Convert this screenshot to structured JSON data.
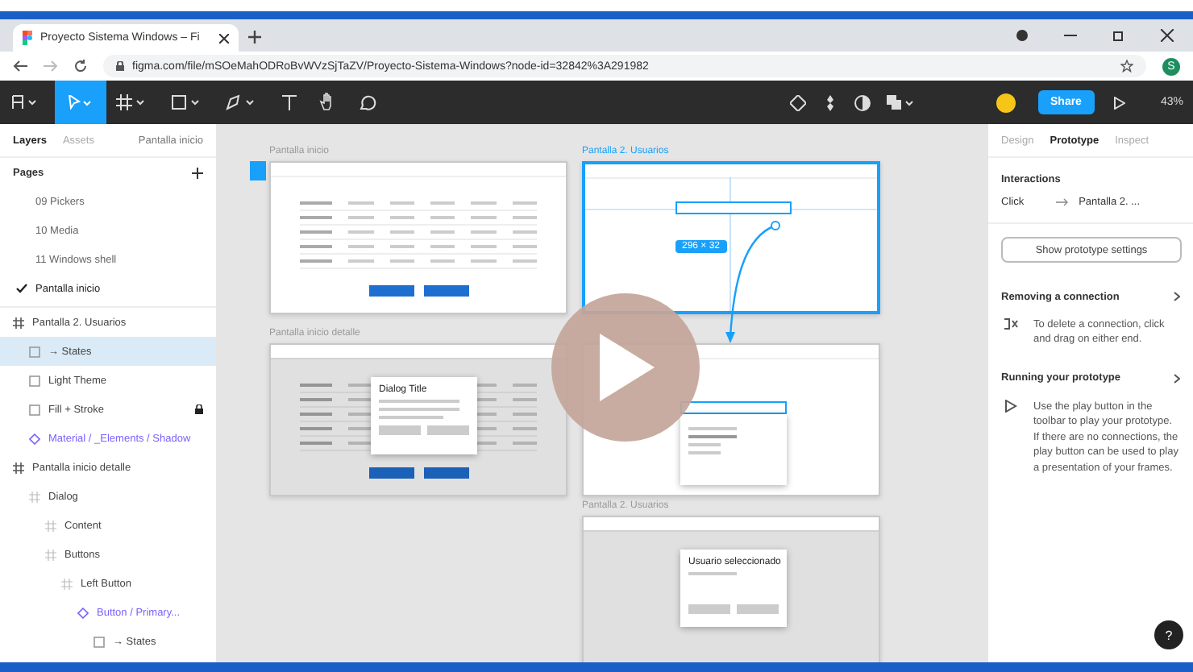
{
  "browser": {
    "tab_title": "Proyecto Sistema Windows – Fi",
    "address": "figma.com/file/mSOeMahODRoBvWVzSjTaZV/Proyecto-Sistema-Windows?node-id=32842%3A291982",
    "profile_initial": "S"
  },
  "toolbar": {
    "share": "Share",
    "zoom": "43%"
  },
  "left_panel": {
    "tabs": [
      {
        "label": "Layers",
        "selected": true
      },
      {
        "label": "Assets",
        "selected": false
      }
    ],
    "page_dropdown": "Pantalla inicio",
    "pages_heading": "Pages",
    "pages": [
      {
        "label": "09 Pickers",
        "selected": false
      },
      {
        "label": "10 Media",
        "selected": false
      },
      {
        "label": "11 Windows shell",
        "selected": false
      },
      {
        "label": "Pantalla inicio",
        "selected": true
      }
    ],
    "layers": [
      {
        "label": "Pantalla 2. Usuarios",
        "kind": "frame",
        "selected": false,
        "locked": false,
        "children": [
          {
            "label": "→ States",
            "kind": "rect",
            "selected": true,
            "locked": false
          },
          {
            "label": "Light Theme",
            "kind": "rect",
            "selected": false,
            "locked": false
          },
          {
            "label": "Fill + Stroke",
            "kind": "rect",
            "selected": false,
            "locked": true
          },
          {
            "label": "Material / _Elements / Shadow",
            "kind": "instance",
            "selected": false,
            "locked": false
          }
        ]
      },
      {
        "label": "Pantalla inicio detalle",
        "kind": "frame",
        "selected": false,
        "locked": false,
        "children": [
          {
            "label": "Dialog",
            "kind": "group",
            "selected": false,
            "locked": false,
            "children": [
              {
                "label": "Content",
                "kind": "group",
                "selected": false,
                "locked": false
              },
              {
                "label": "Buttons",
                "kind": "group",
                "selected": false,
                "locked": false,
                "children": [
                  {
                    "label": "Left Button",
                    "kind": "group",
                    "selected": false,
                    "locked": false,
                    "children": [
                      {
                        "label": "Button / Primary...",
                        "kind": "instance",
                        "selected": false,
                        "locked": false,
                        "children": [
                          {
                            "label": "→ States",
                            "kind": "rect",
                            "selected": false,
                            "locked": false
                          }
                        ]
                      }
                    ]
                  }
                ]
              }
            ]
          }
        ]
      }
    ]
  },
  "canvas": {
    "frames": [
      {
        "label": "Pantalla inicio",
        "kind": "table",
        "selected": false
      },
      {
        "label": "Pantalla 2. Usuarios",
        "kind": "input",
        "selected": true,
        "size_badge": "296 × 32"
      },
      {
        "label": "Pantalla inicio detalle",
        "kind": "dialog",
        "selected": false,
        "dialog_title": "Dialog Title"
      },
      {
        "kind": "dropdown",
        "selected": false
      },
      {
        "label": "Pantalla 2. Usuarios",
        "kind": "confirm",
        "selected": false,
        "dialog_title": "Usuario seleccionado"
      }
    ]
  },
  "right_panel": {
    "tabs": [
      {
        "label": "Design",
        "selected": false
      },
      {
        "label": "Prototype",
        "selected": true
      },
      {
        "label": "Inspect",
        "selected": false
      }
    ],
    "interactions_heading": "Interactions",
    "interaction": {
      "trigger": "Click",
      "target": "Pantalla 2. ..."
    },
    "settings_button": "Show prototype settings",
    "tips": [
      {
        "kind": "connection",
        "title": "Removing a connection",
        "body": "To delete a connection, click and drag on either end."
      },
      {
        "kind": "play",
        "title": "Running your prototype",
        "body": "Use the play button in the toolbar to play your prototype. If there are no connections, the play button can be used to play a presentation of your frames."
      }
    ],
    "help": "?"
  }
}
